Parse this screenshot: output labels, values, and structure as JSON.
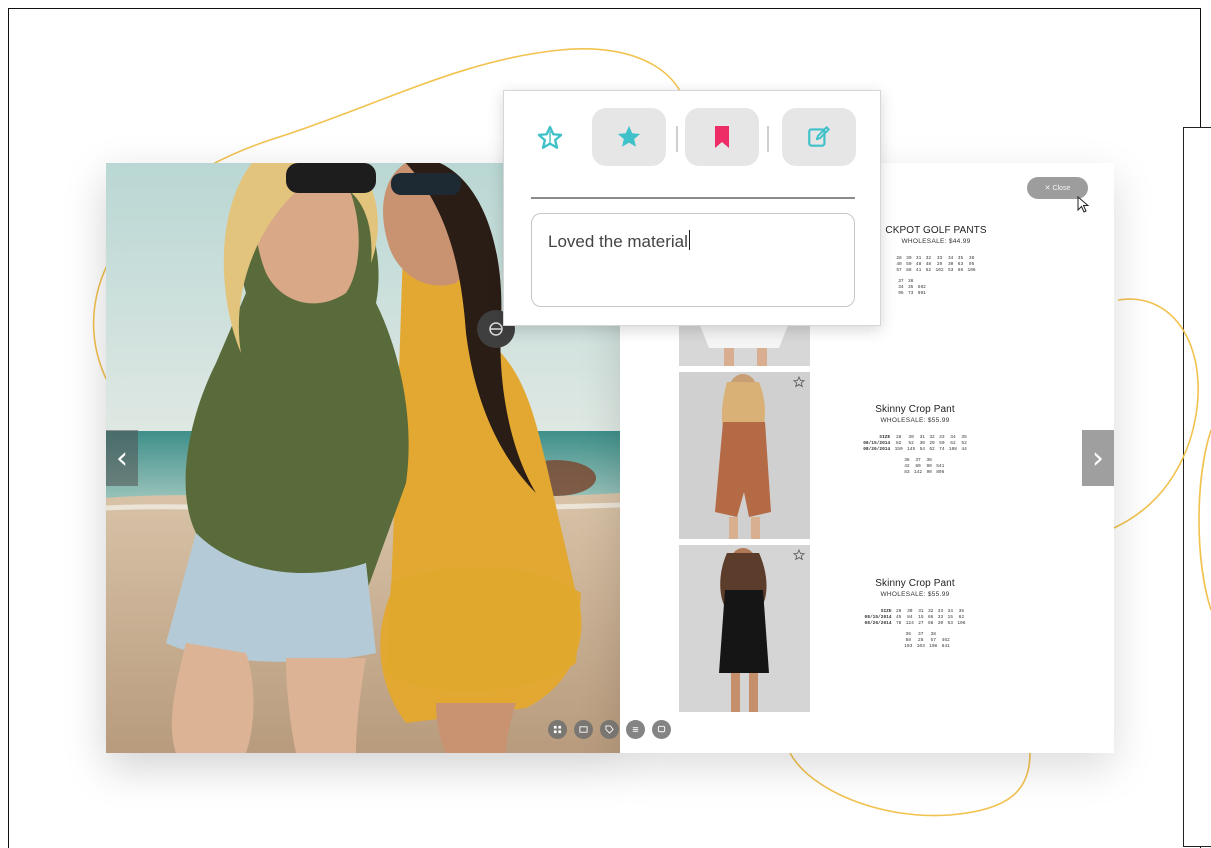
{
  "popup": {
    "buttons": [
      {
        "name": "star-outline-button",
        "icon": "star-outline-icon",
        "color": "#3fc1c9"
      },
      {
        "name": "star-filled-button",
        "icon": "star-filled-icon",
        "color": "#3fc1c9"
      },
      {
        "name": "bookmark-button",
        "icon": "bookmark-icon",
        "color": "#ee2d67"
      },
      {
        "name": "edit-note-button",
        "icon": "edit-icon",
        "color": "#3fc1c9"
      }
    ],
    "note_value": "Loved the material"
  },
  "catalog": {
    "close_label": "✕  Close",
    "products": [
      {
        "name": "JACKPOT GOLF PANTS",
        "name_visible": "CKPOT GOLF PANTS",
        "wholesale": "WHOLESALE: $44.99",
        "rows": [
          [
            "28",
            "30",
            "31",
            "32",
            "33",
            "34",
            "35",
            "36"
          ],
          [
            "40",
            "50",
            "48",
            "48",
            "29",
            "30",
            "63",
            "95"
          ],
          [
            "57",
            "88",
            "41",
            "62",
            "102",
            "53",
            "86",
            "106"
          ]
        ],
        "sub_rows": [
          [
            "37",
            "38"
          ],
          [
            "34",
            "35",
            "592"
          ],
          [
            "95",
            "73",
            "991"
          ]
        ]
      },
      {
        "name": "Skinny Crop Pant",
        "wholesale": "WHOLESALE: $55.99",
        "header": [
          "SIZE",
          "28",
          "30",
          "31",
          "32",
          "33",
          "34",
          "35"
        ],
        "rows": [
          [
            "08/15/2014",
            "82",
            "52",
            "30",
            "29",
            "50",
            "62",
            "52"
          ],
          [
            "08/26/2014",
            "150",
            "145",
            "54",
            "62",
            "74",
            "108",
            "44"
          ]
        ],
        "sub_rows": [
          [
            "36",
            "37",
            "38"
          ],
          [
            "42",
            "80",
            "90",
            "541"
          ],
          [
            "83",
            "142",
            "90",
            "896"
          ]
        ]
      },
      {
        "name": "Skinny Crop Pant",
        "wholesale": "WHOLESALE: $55.99",
        "header": [
          "SIZE",
          "28",
          "30",
          "31",
          "32",
          "33",
          "34",
          "35"
        ],
        "rows": [
          [
            "08/15/2014",
            "45",
            "84",
            "15",
            "66",
            "33",
            "15",
            "62"
          ],
          [
            "08/26/2014",
            "78",
            "124",
            "27",
            "66",
            "30",
            "53",
            "106"
          ]
        ],
        "sub_rows": [
          [
            "36",
            "37",
            "38"
          ],
          [
            "88",
            "28",
            "57",
            "462"
          ],
          [
            "103",
            "103",
            "108",
            "841"
          ]
        ]
      }
    ]
  },
  "colors": {
    "accent_teal": "#3fc1c9",
    "accent_pink": "#ee2d67",
    "decor_line": "#f2c24f"
  }
}
